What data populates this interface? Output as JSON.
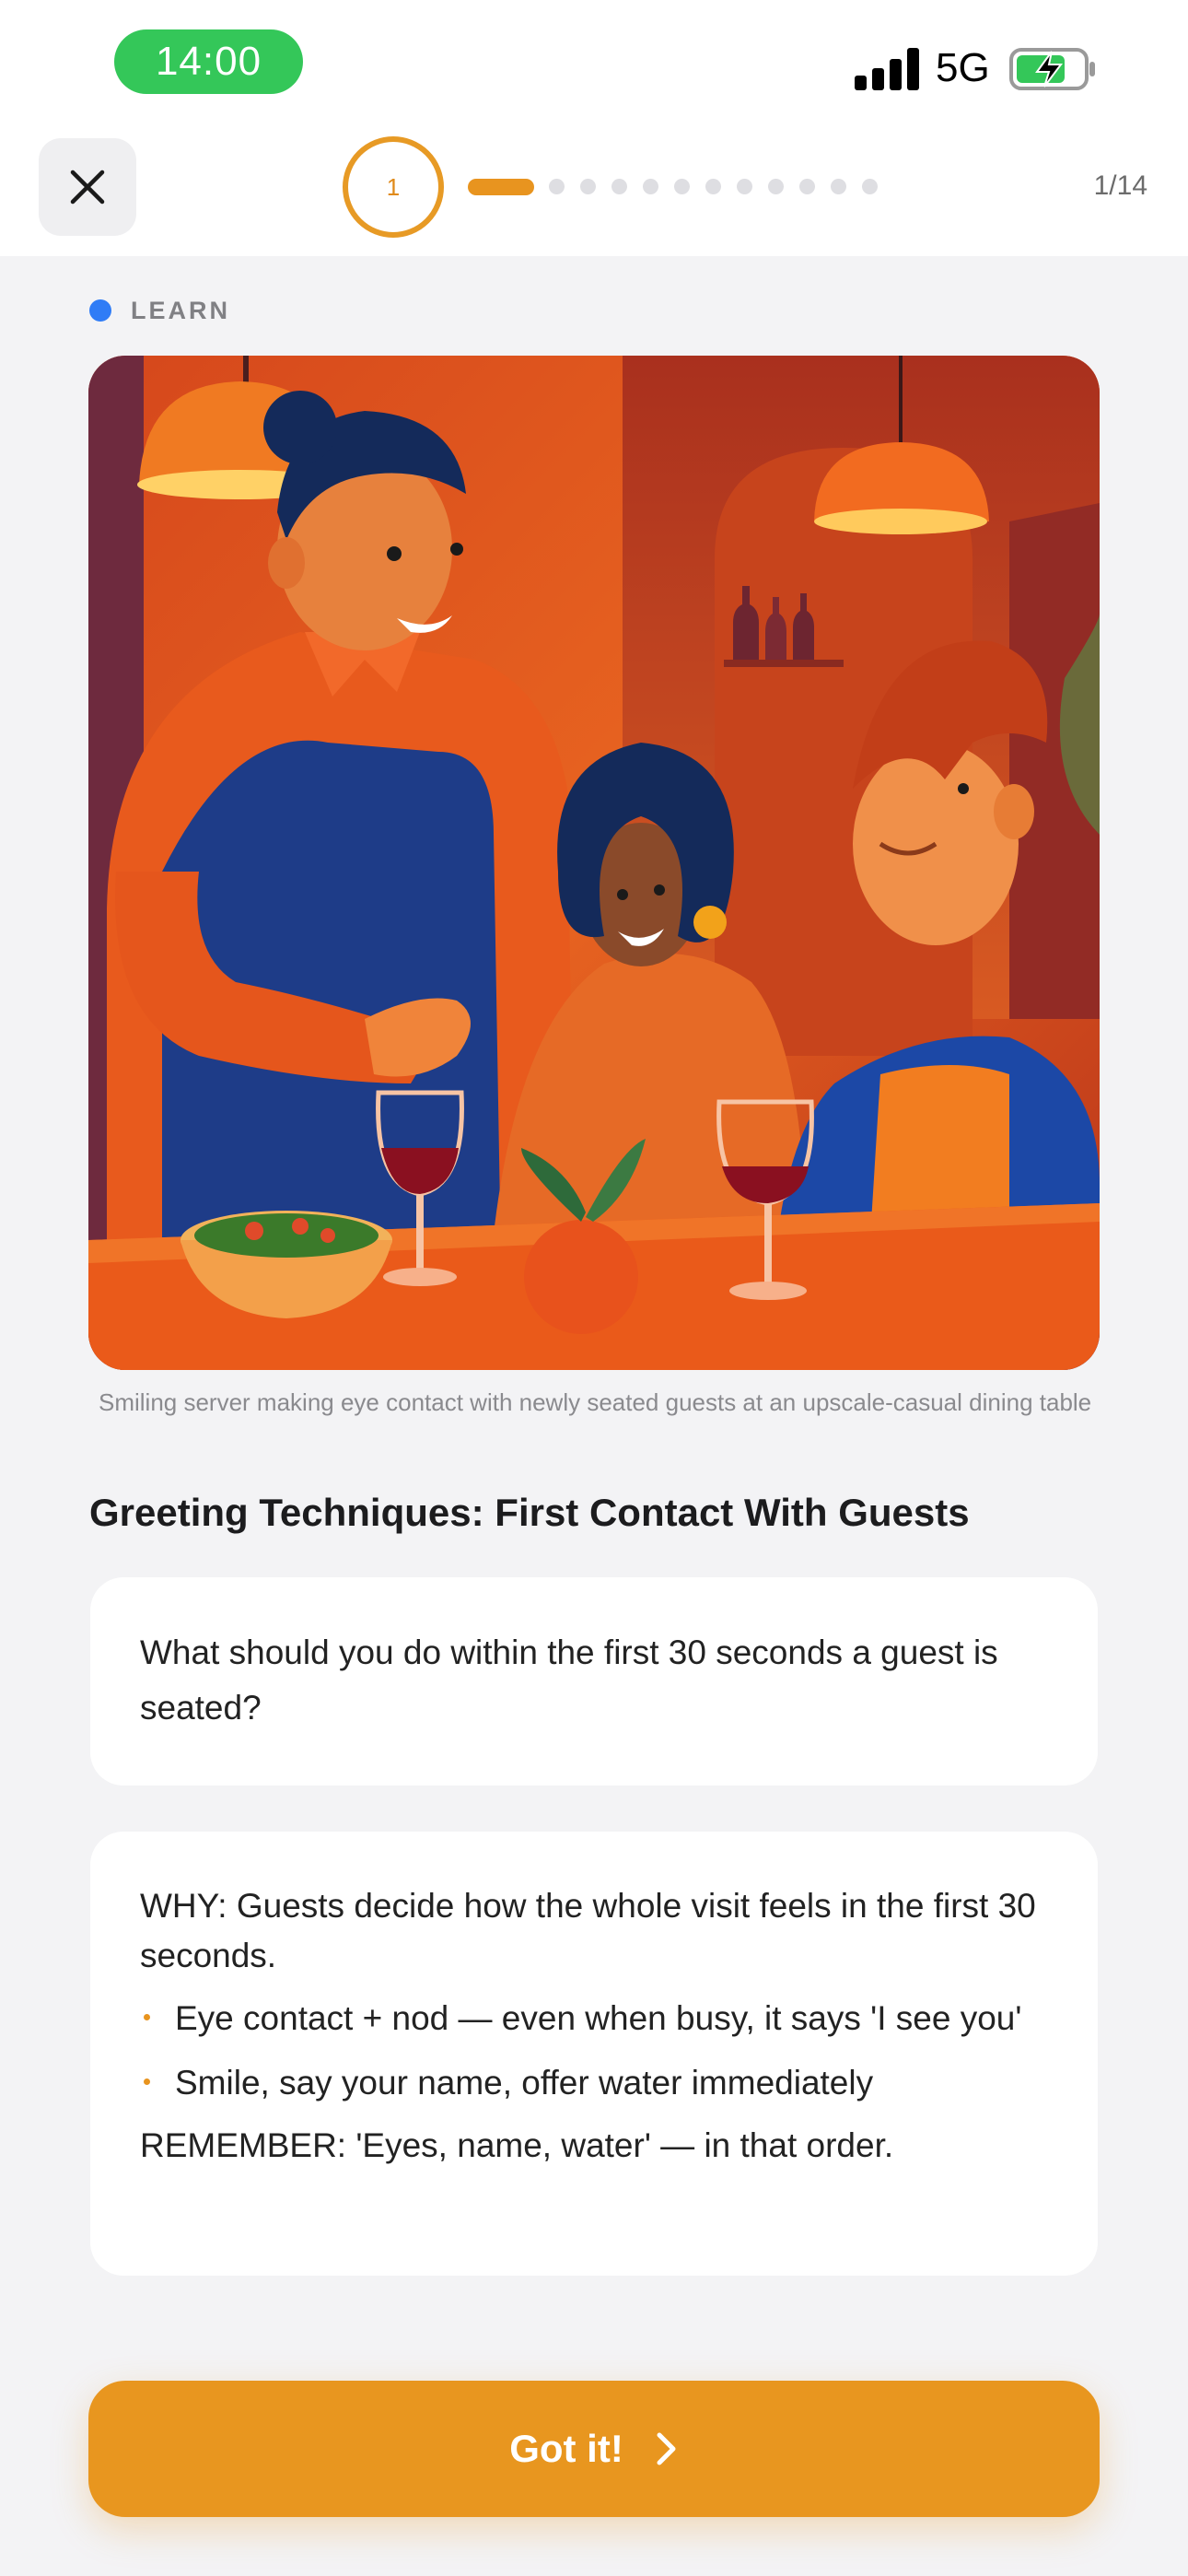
{
  "status_bar": {
    "time": "14:00",
    "network": "5G",
    "icons": [
      "signal-icon",
      "battery-charging-icon"
    ]
  },
  "header": {
    "close_icon": "close-icon",
    "current_step": "1",
    "step_counter": "1/14",
    "progress": {
      "current": 1,
      "total": 14
    },
    "accent_color": "#e8941f"
  },
  "lesson": {
    "tag": "LEARN",
    "tag_color": "#2f7cf6",
    "image_caption": "Smiling server making eye contact with newly seated guests at an upscale-casual dining table",
    "title": "Greeting Techniques: First Contact With Guests",
    "question": "What should you do within the first 30 seconds a guest is seated?",
    "why": "WHY: Guests decide how the whole visit feels in the first 30 seconds.",
    "bullets": [
      "Eye contact + nod — even when busy, it says 'I see you'",
      "Smile, say your name, offer water immediately"
    ],
    "remember": "REMEMBER: 'Eyes, name, water' — in that order."
  },
  "cta": {
    "label": "Got it!",
    "icon": "chevron-right-icon"
  }
}
